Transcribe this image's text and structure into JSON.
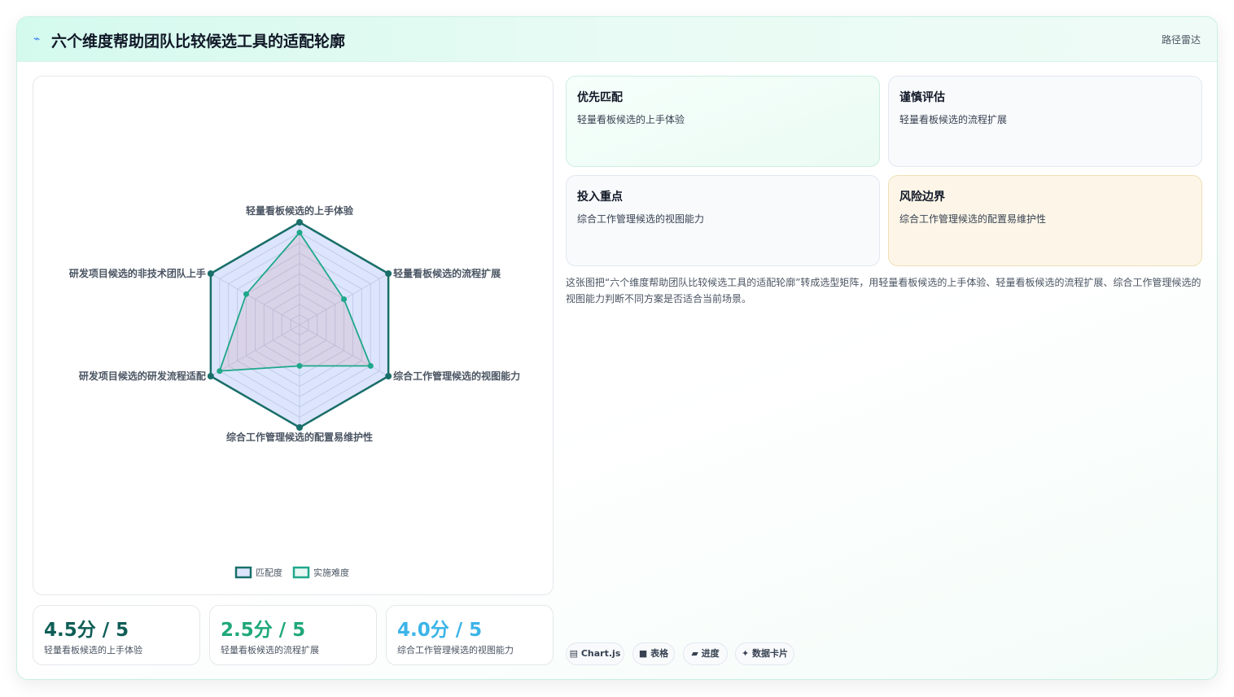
{
  "header": {
    "icon": "trend-line-icon",
    "title": "六个维度帮助团队比较候选工具的适配轮廓",
    "tag": "路径雷达"
  },
  "chart_data": {
    "type": "radar",
    "axes": [
      "轻量看板候选的上手体验",
      "轻量看板候选的流程扩展",
      "综合工作管理候选的视图能力",
      "综合工作管理候选的配置易维护性",
      "研发项目候选的研发流程适配",
      "研发项目候选的非技术团队上手"
    ],
    "rlim": [
      0,
      5
    ],
    "grid_levels": 10,
    "series": [
      {
        "name": "匹配度",
        "values": [
          5,
          5,
          5,
          5,
          5,
          5
        ],
        "color": "#1a6f6a"
      },
      {
        "name": "实施难度",
        "values": [
          4.5,
          2.5,
          4.0,
          2.0,
          4.5,
          3.0
        ],
        "color": "#1fa88a"
      }
    ],
    "legend_position": "bottom"
  },
  "stats": [
    {
      "value": "4.5分 / 5",
      "label": "轻量看板候选的上手体验",
      "color": "#0f5e57"
    },
    {
      "value": "2.5分 / 5",
      "label": "轻量看板候选的流程扩展",
      "color": "#1fa87a"
    },
    {
      "value": "4.0分 / 5",
      "label": "综合工作管理候选的视图能力",
      "color": "#3cb4e8"
    }
  ],
  "insights": [
    {
      "title": "优先匹配",
      "text": "轻量看板候选的上手体验"
    },
    {
      "title": "谨慎评估",
      "text": "轻量看板候选的流程扩展"
    },
    {
      "title": "投入重点",
      "text": "综合工作管理候选的视图能力"
    },
    {
      "title": "风险边界",
      "text": "综合工作管理候选的配置易维护性"
    }
  ],
  "description": "这张图把“六个维度帮助团队比较候选工具的适配轮廓”转成选型矩阵，用轻量看板候选的上手体验、轻量看板候选的流程扩展、综合工作管理候选的视图能力判断不同方案是否适合当前场景。",
  "chips": [
    {
      "icon": "chart-icon",
      "glyph": "▤",
      "label": "Chart.js"
    },
    {
      "icon": "table-icon",
      "glyph": "■",
      "label": "表格"
    },
    {
      "icon": "progress-icon",
      "glyph": "▰",
      "label": "进度"
    },
    {
      "icon": "sparkle-icon",
      "glyph": "✦",
      "label": "数据卡片"
    }
  ]
}
